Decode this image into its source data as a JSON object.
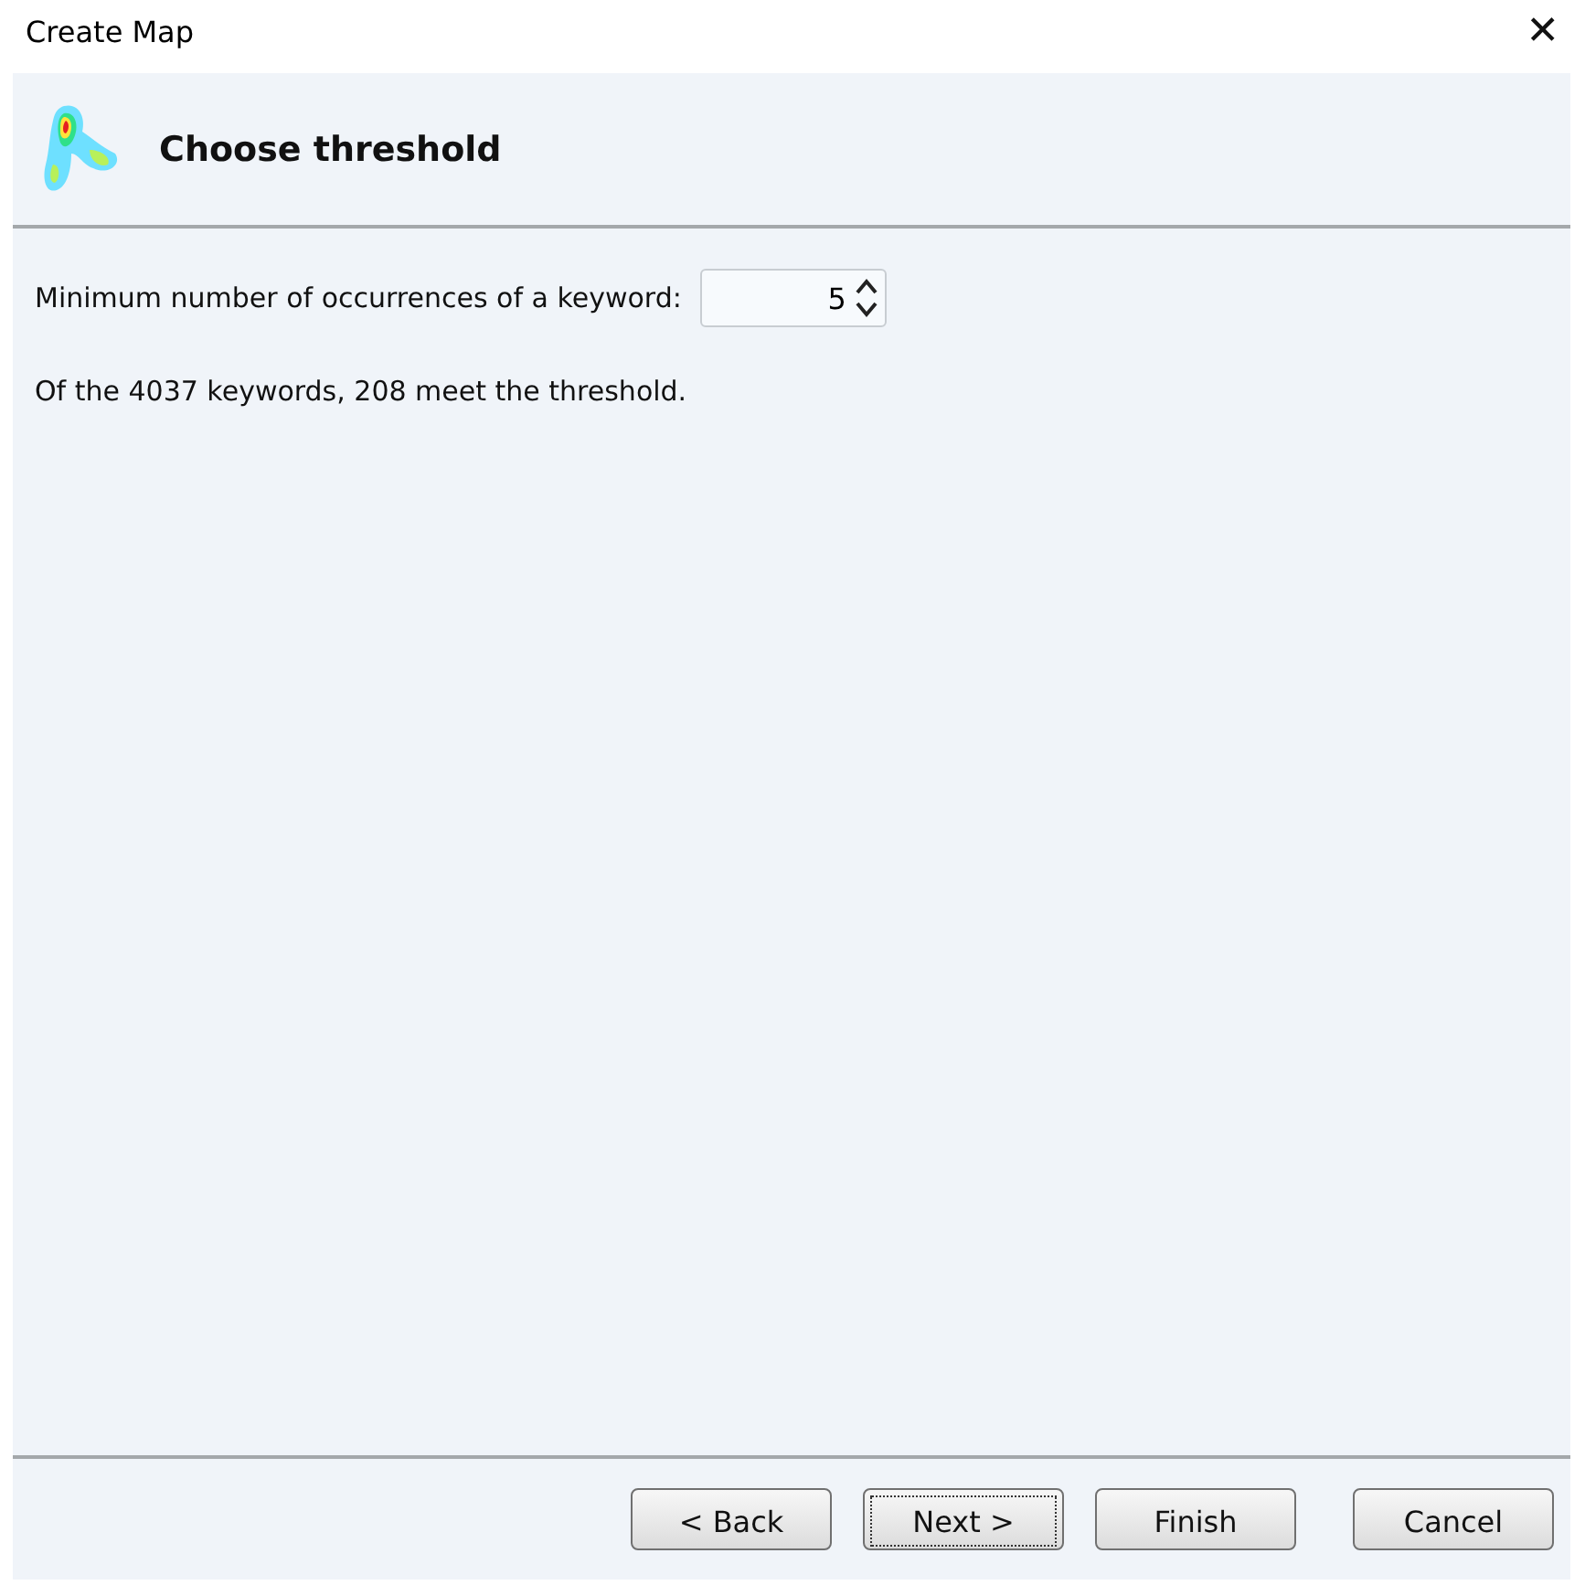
{
  "window": {
    "title": "Create Map",
    "close": "✕"
  },
  "header": {
    "title": "Choose threshold"
  },
  "threshold": {
    "label": "Minimum number of occurrences of a keyword:",
    "value": "5"
  },
  "summary": "Of the 4037 keywords, 208 meet the threshold.",
  "buttons": [
    {
      "label": "< Back",
      "focused": false
    },
    {
      "label": "Next >",
      "focused": true
    },
    {
      "label": "Finish",
      "focused": false
    },
    {
      "label": "Cancel",
      "focused": false
    }
  ]
}
